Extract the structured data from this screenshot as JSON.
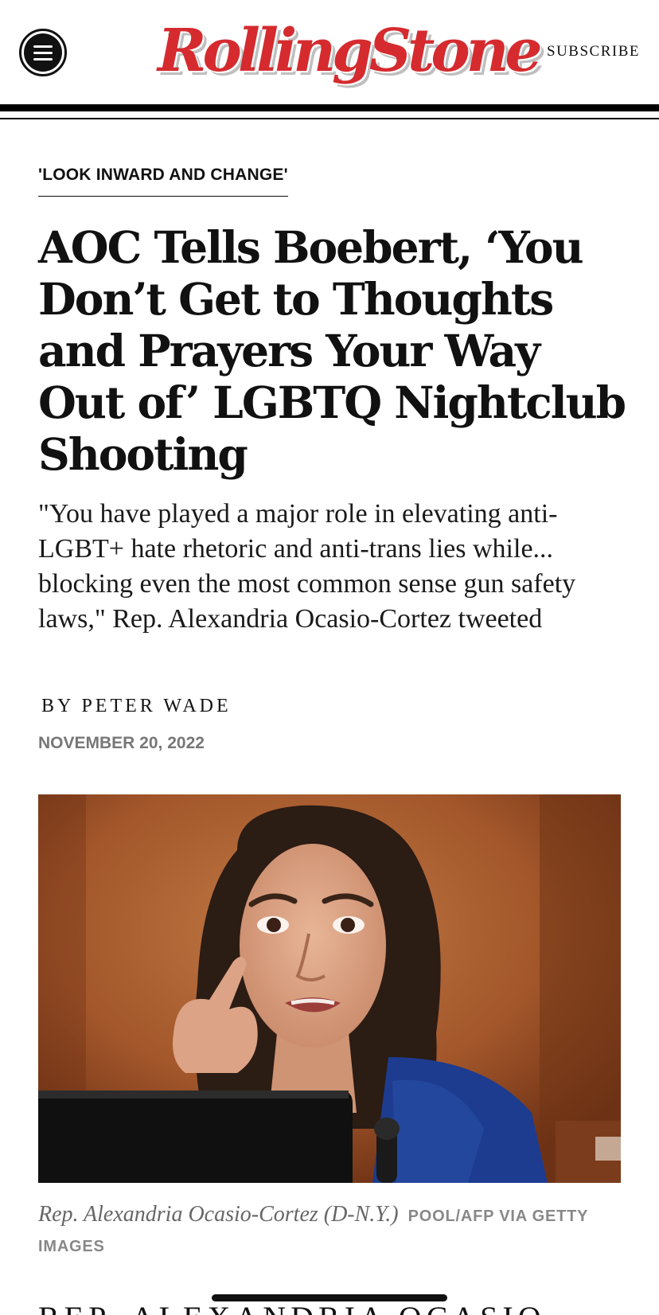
{
  "header": {
    "logo_text": "RollingStone",
    "subscribe_label": "SUBSCRIBE",
    "brand_color": "#d52b2f",
    "menu_icon": "hamburger-menu-icon"
  },
  "article": {
    "kicker": "'LOOK INWARD AND CHANGE'",
    "headline": "AOC Tells Boebert, ‘You Don’t Get to Thoughts and Prayers Your Way Out of’ LGBTQ Nightclub Shooting",
    "dek": "\"You have played a major role in elevating anti-LGBT+ hate rhetoric and anti-trans lies while... blocking even the most common sense gun safety laws,\" Rep. Alexandria Ocasio-Cortez tweeted",
    "byline": "BY PETER WADE",
    "date": "NOVEMBER 20, 2022"
  },
  "image": {
    "caption": "Rep. Alexandria Ocasio-Cortez (D-N.Y.)",
    "credit": "POOL/AFP VIA GETTY IMAGES"
  },
  "next_section": {
    "heading": "REP. ALEXANDRIA OCASIO-"
  }
}
